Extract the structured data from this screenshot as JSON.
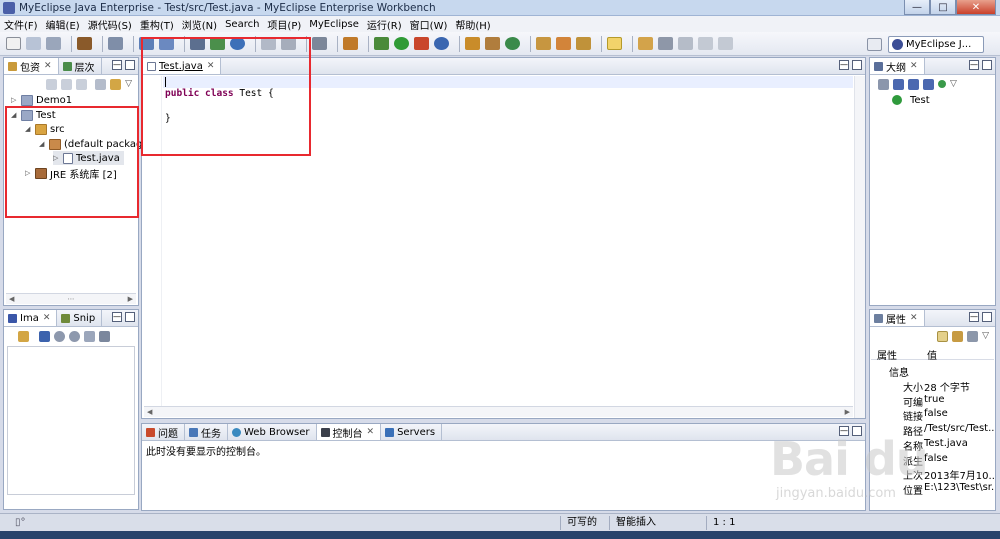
{
  "window": {
    "title": "MyEclipse Java Enterprise - Test/src/Test.java - MyEclipse Enterprise Workbench",
    "min": "—",
    "max": "□",
    "close": "✕"
  },
  "menu": [
    "文件(F)",
    "编辑(E)",
    "源代码(S)",
    "重构(T)",
    "浏览(N)",
    "Search",
    "项目(P)",
    "MyEclipse",
    "运行(R)",
    "窗口(W)",
    "帮助(H)"
  ],
  "perspective": {
    "label": "MyEclipse J..."
  },
  "package_explorer": {
    "tabs": [
      {
        "label": "包资",
        "active": true
      },
      {
        "label": "层次",
        "active": false
      }
    ],
    "tree": [
      {
        "label": "Demo1",
        "depth": 0,
        "twisty": "▷",
        "icon": "project-icon"
      },
      {
        "label": "Test",
        "depth": 0,
        "twisty": "◢",
        "icon": "project-icon"
      },
      {
        "label": "src",
        "depth": 1,
        "twisty": "◢",
        "icon": "source-folder-icon"
      },
      {
        "label": "(default package",
        "depth": 2,
        "twisty": "◢",
        "icon": "package-icon"
      },
      {
        "label": "Test.java",
        "depth": 3,
        "twisty": "▷",
        "icon": "java-file-icon"
      },
      {
        "label": "JRE 系统库 [2]",
        "depth": 1,
        "twisty": "▷",
        "icon": "library-icon"
      }
    ]
  },
  "image_pane": {
    "tabs": [
      {
        "label": "Ima",
        "active": true
      },
      {
        "label": "Snip",
        "active": false
      }
    ]
  },
  "editor": {
    "tab": "Test.java",
    "lines": [
      {
        "parts": [
          {
            "text": "public class",
            "kw": true
          },
          {
            "text": " Test {",
            "kw": false
          }
        ]
      },
      {
        "parts": [
          {
            "text": "",
            "kw": false
          }
        ]
      },
      {
        "parts": [
          {
            "text": "}",
            "kw": false
          }
        ]
      }
    ]
  },
  "outline": {
    "tab": "大纲",
    "items": [
      {
        "label": "Test"
      }
    ]
  },
  "properties": {
    "tab": "属性",
    "col_property": "属性",
    "col_value": "值",
    "category": "信息",
    "rows": [
      {
        "name": "大小",
        "value": "28 个字节"
      },
      {
        "name": "可编",
        "value": "true"
      },
      {
        "name": "链接",
        "value": "false"
      },
      {
        "name": "路径",
        "value": "/Test/src/Test..."
      },
      {
        "name": "名称",
        "value": "Test.java"
      },
      {
        "name": "派生",
        "value": "false"
      },
      {
        "name": "上次",
        "value": "2013年7月10..."
      },
      {
        "name": "位置",
        "value": "E:\\123\\Test\\sr..."
      }
    ]
  },
  "bottom_panel": {
    "tabs": [
      {
        "label": "问题",
        "active": false
      },
      {
        "label": "任务",
        "active": false
      },
      {
        "label": "Web Browser",
        "active": false
      },
      {
        "label": "控制台",
        "active": true
      },
      {
        "label": "Servers",
        "active": false
      }
    ],
    "message": "此时没有要显示的控制台。"
  },
  "status": {
    "writable": "可写的",
    "insert_mode": "智能插入",
    "position": "1 : 1"
  },
  "watermark": {
    "brand": "Bai du",
    "url": "jingyan.baidu.com"
  },
  "colors": {
    "annotation": "#e8292f",
    "keyword": "#7f0055"
  }
}
